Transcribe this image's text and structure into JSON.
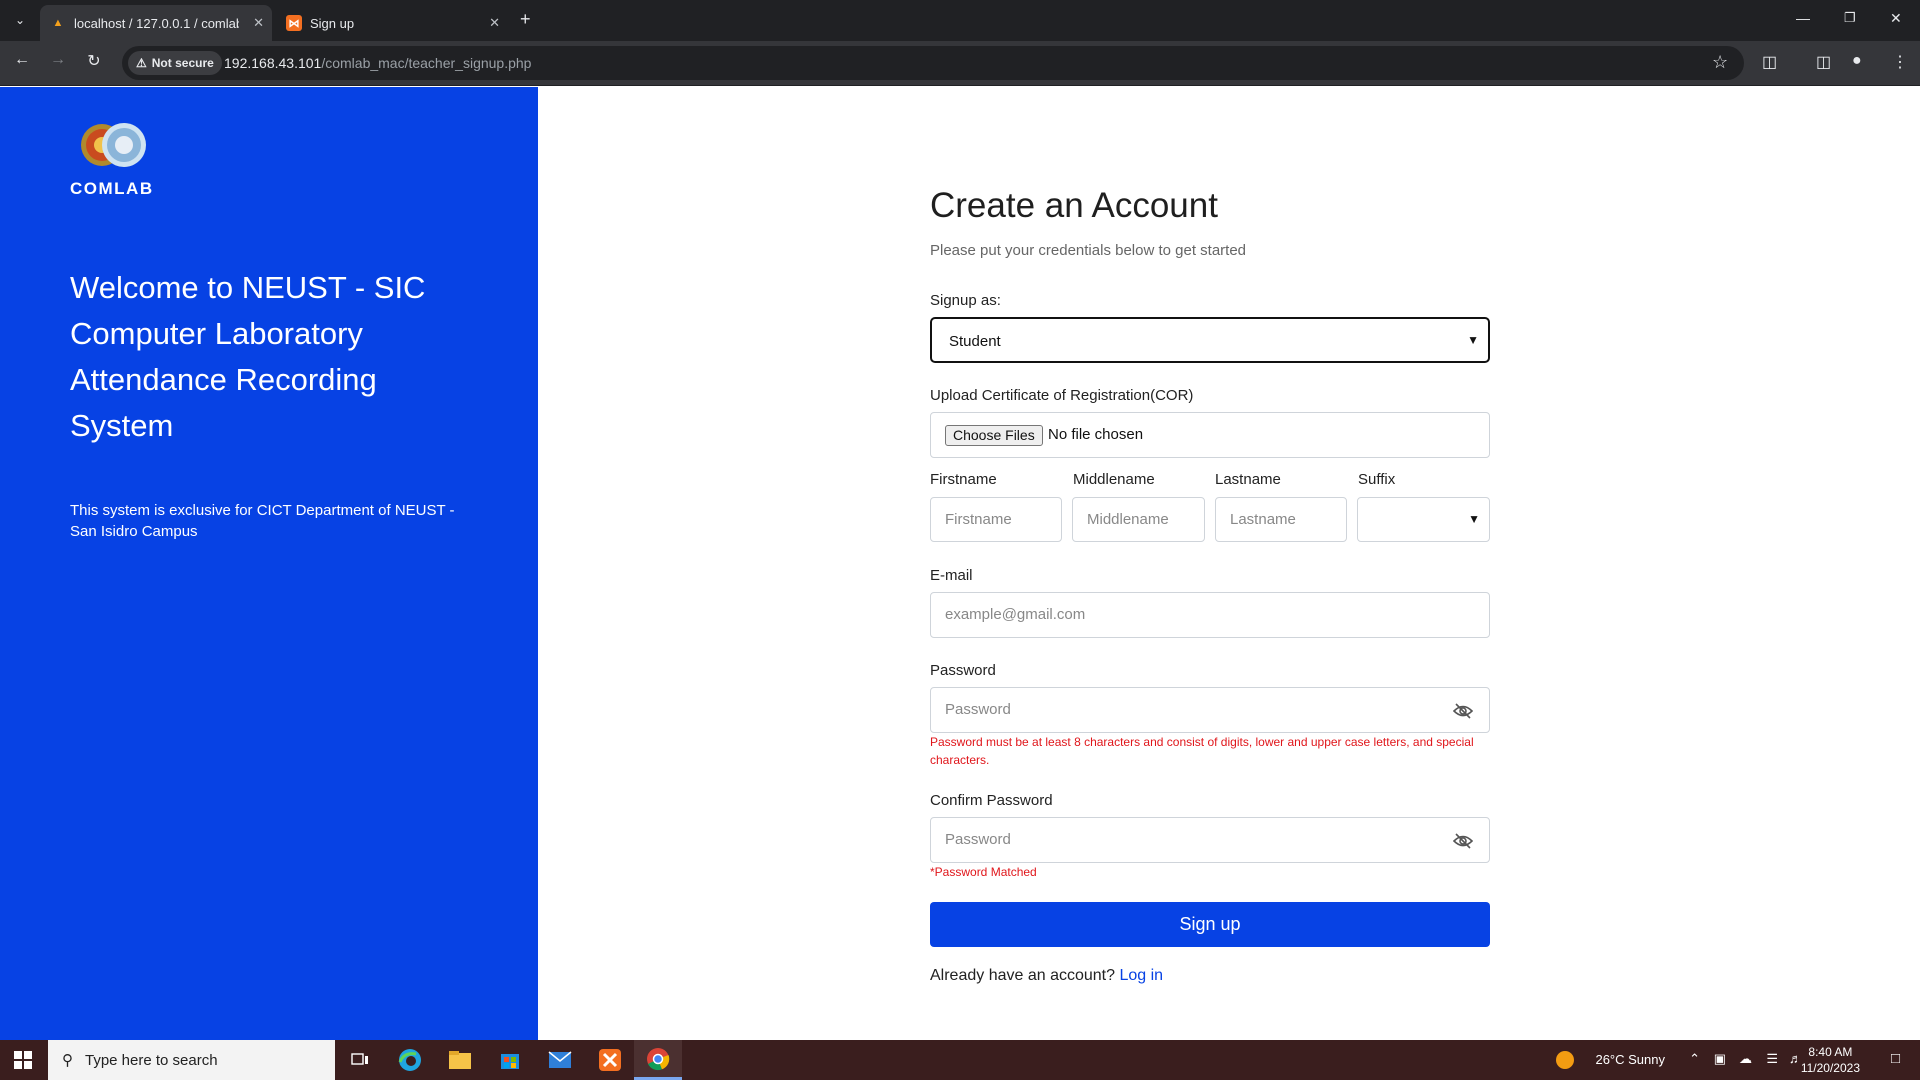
{
  "browser": {
    "tabs": [
      {
        "title": "localhost / 127.0.0.1 / comlab_mac",
        "active": true
      },
      {
        "title": "Sign up",
        "active": false
      }
    ],
    "security_label": "Not secure",
    "url_host": "192.168.43.101",
    "url_path": "/comlab_mac/teacher_signup.php"
  },
  "sidebar": {
    "brand": "COMLAB",
    "welcome": "Welcome to NEUST - SIC Computer Laboratory Attendance Recording System",
    "exclusive": "This system is exclusive for CICT Department of NEUST - San Isidro Campus"
  },
  "form": {
    "title": "Create an Account",
    "subtitle": "Please put your credentials below to get started",
    "signup_as_label": "Signup as:",
    "signup_as_value": "Student",
    "upload_label": "Upload Certificate of Registration(COR)",
    "choose_files": "Choose Files",
    "no_file": "No file chosen",
    "firstname_label": "Firstname",
    "firstname_placeholder": "Firstname",
    "middlename_label": "Middlename",
    "middlename_placeholder": "Middlename",
    "lastname_label": "Lastname",
    "lastname_placeholder": "Lastname",
    "suffix_label": "Suffix",
    "suffix_value": "",
    "email_label": "E-mail",
    "email_placeholder": "example@gmail.com",
    "password_label": "Password",
    "password_placeholder": "Password",
    "password_warning": "Password must be at least 8 characters and consist of digits, lower and upper case letters, and special characters.",
    "confirm_label": "Confirm Password",
    "confirm_placeholder": "Password",
    "matched": "*Password Matched",
    "signup_button": "Sign up",
    "already_text": "Already have an account?",
    "login_link": "Log in"
  },
  "taskbar": {
    "search_placeholder": "Type here to search",
    "weather": "26°C  Sunny",
    "time": "8:40 AM",
    "date": "11/20/2023"
  },
  "colors": {
    "brand_blue": "#0742e4",
    "warning_red": "#e0161b",
    "chrome_dark": "#202124",
    "taskbar": "#3a1e1e"
  }
}
